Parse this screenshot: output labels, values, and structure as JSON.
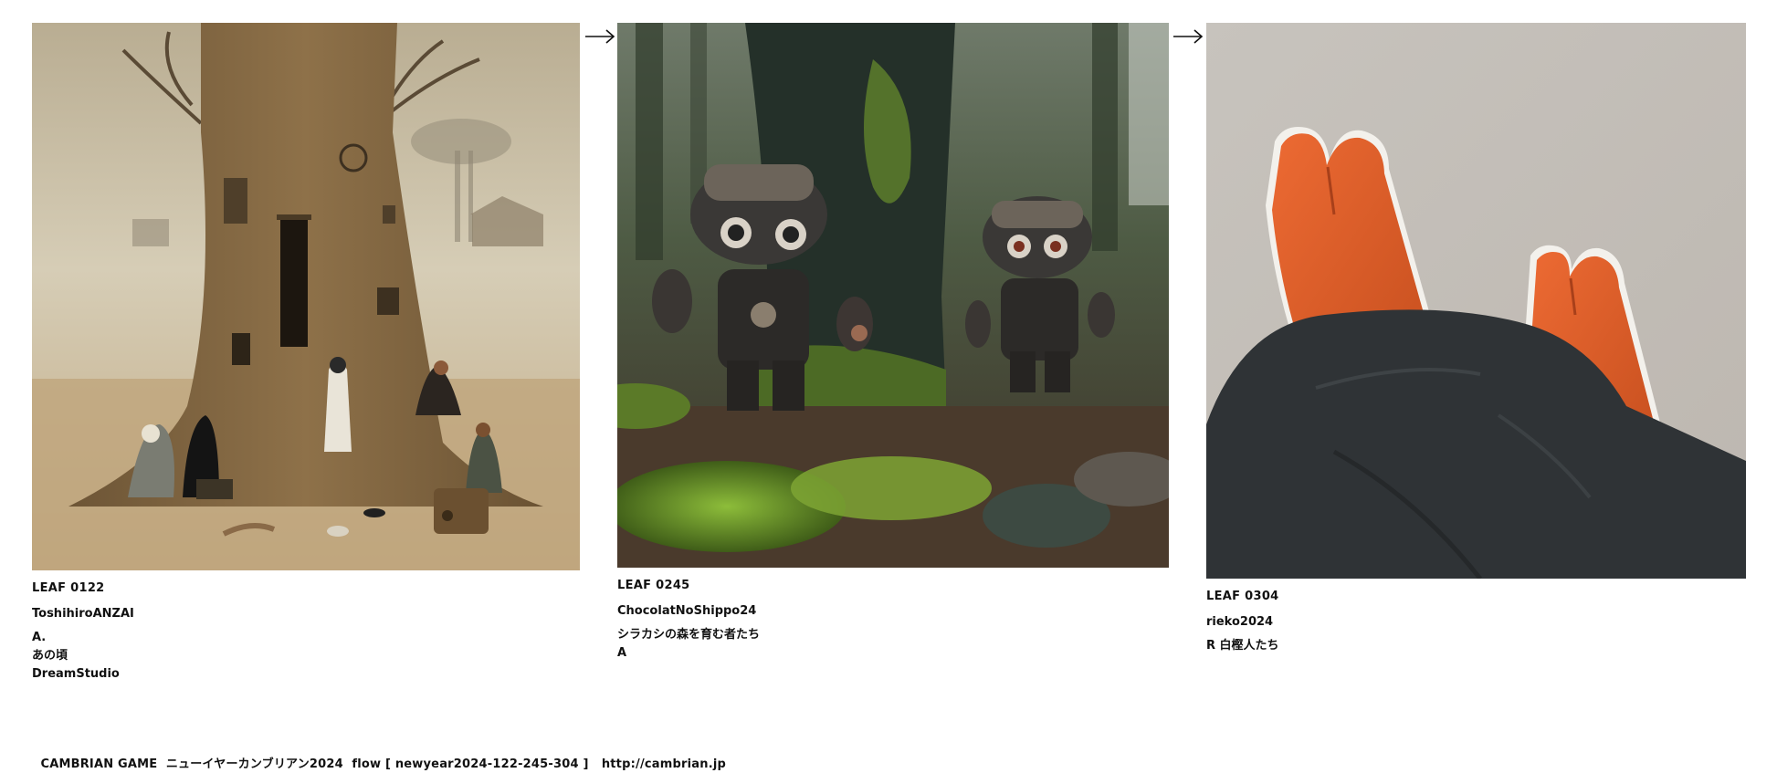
{
  "leaves": [
    {
      "code": "LEAF 0122",
      "author": "ToshihiroANZAI",
      "notes": [
        "A.",
        "あの頃",
        "DreamStudio"
      ],
      "image": "sepia-tree-painting"
    },
    {
      "code": "LEAF 0245",
      "author": "ChocolatNoShippo24",
      "notes": [
        "シラカシの森を育む者たち",
        "A"
      ],
      "image": "forest-robot-figures"
    },
    {
      "code": "LEAF 0304",
      "author": "rieko2024",
      "notes": [
        "R 白樫人たち"
      ],
      "image": "orange-tabi-socks"
    }
  ],
  "arrows": [
    "right-arrow-icon",
    "right-arrow-icon"
  ],
  "footer": {
    "game": "CAMBRIAN GAME",
    "title": "ニューイヤーカンブリアン2024",
    "flow": "flow [ newyear2024-122-245-304 ]",
    "url": "http://cambrian.jp"
  }
}
